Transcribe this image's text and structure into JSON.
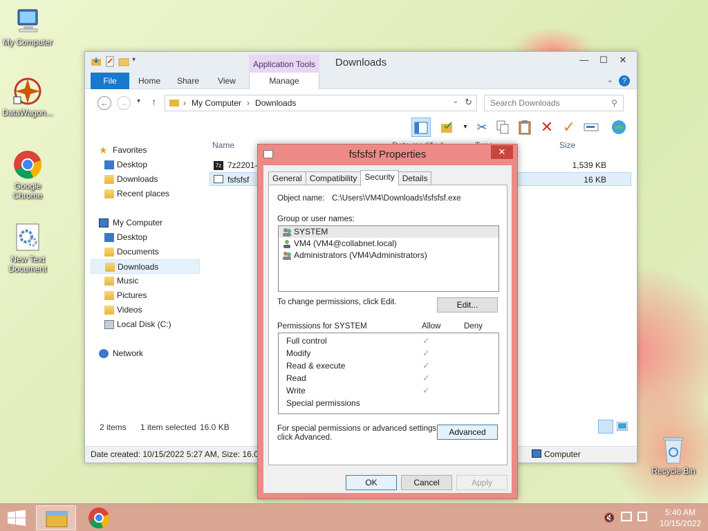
{
  "desktop": {
    "icons": [
      {
        "label": "My Computer"
      },
      {
        "label": "DataWagon..."
      },
      {
        "label": "Google Chrome"
      },
      {
        "label": "New Text Document"
      },
      {
        "label": "Recycle Bin"
      }
    ]
  },
  "explorer": {
    "title": "Downloads",
    "context_tab": "Application Tools",
    "ribbon_tabs": [
      "File",
      "Home",
      "Share",
      "View",
      "Manage"
    ],
    "address": [
      "My Computer",
      "Downloads"
    ],
    "search_placeholder": "Search Downloads",
    "nav": {
      "favorites": "Favorites",
      "favorites_items": [
        "Desktop",
        "Downloads",
        "Recent places"
      ],
      "computer": "My Computer",
      "computer_items": [
        "Desktop",
        "Documents",
        "Downloads",
        "Music",
        "Pictures",
        "Videos",
        "Local Disk (C:)"
      ],
      "network": "Network"
    },
    "columns": {
      "name": "Name",
      "date": "Date modified",
      "type": "Type",
      "size": "Size"
    },
    "files": [
      {
        "name": "7z2201-x",
        "size": "1,539 KB"
      },
      {
        "name": "fsfsfsf",
        "size": "16 KB"
      }
    ],
    "status": {
      "count": "2 items",
      "selected": "1 item selected",
      "size": "16.0 KB"
    },
    "details": {
      "date_created": "Date created: 10/15/2022 5:27 AM, Size: 16.0 K",
      "location": "Computer"
    }
  },
  "dialog": {
    "title": "fsfsfsf Properties",
    "tabs": [
      "General",
      "Compatibility",
      "Security",
      "Details"
    ],
    "object_label": "Object name:",
    "object_value": "C:\\Users\\VM4\\Downloads\\fsfsfsf.exe",
    "group_label": "Group or user names:",
    "users": [
      "SYSTEM",
      "VM4 (VM4@collabnet.local)",
      "Administrators (VM4\\Administrators)"
    ],
    "change_text": "To change permissions, click Edit.",
    "edit_button": "Edit...",
    "perm_label": "Permissions for SYSTEM",
    "allow": "Allow",
    "deny": "Deny",
    "permissions": [
      {
        "name": "Full control",
        "allow": true
      },
      {
        "name": "Modify",
        "allow": true
      },
      {
        "name": "Read & execute",
        "allow": true
      },
      {
        "name": "Read",
        "allow": true
      },
      {
        "name": "Write",
        "allow": true
      },
      {
        "name": "Special permissions",
        "allow": false
      }
    ],
    "special_text_1": "For special permissions or advanced settings,",
    "special_text_2": "click Advanced.",
    "advanced_button": "Advanced",
    "ok": "OK",
    "cancel": "Cancel",
    "apply": "Apply",
    "check_glyph": "✓"
  },
  "taskbar": {
    "time": "5:40 AM",
    "date": "10/15/2022"
  }
}
